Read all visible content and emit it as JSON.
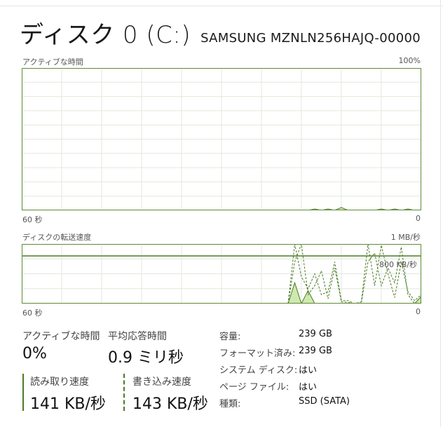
{
  "header": {
    "title": "ディスク 0 (C:)",
    "model": "SAMSUNG MZNLN256HAJQ-00000"
  },
  "active_chart": {
    "label": "アクティブな時間",
    "max_label": "100%",
    "x_left": "60 秒",
    "x_right": "0",
    "ylim": [
      0,
      100
    ],
    "series": [
      {
        "values": [
          0,
          0,
          0,
          0,
          0,
          0,
          0,
          0,
          0,
          0,
          0,
          0,
          0,
          0,
          0,
          0,
          0,
          0,
          0,
          0,
          0,
          0,
          0,
          0,
          0,
          0,
          0,
          0,
          0,
          0,
          0,
          0,
          0,
          0,
          0,
          0,
          0,
          0,
          0,
          0,
          0,
          0,
          0,
          0,
          1,
          0,
          1,
          0,
          2,
          0,
          0,
          0,
          0,
          0,
          1,
          0,
          1,
          0,
          1,
          0,
          0
        ]
      }
    ]
  },
  "transfer_chart": {
    "label": "ディスクの転送速度",
    "max_label": "1 MB/秒",
    "ref_label": "800 KB/秒",
    "x_left": "60 秒",
    "x_right": "0",
    "ylim": [
      0,
      1000
    ],
    "ref_value": 800,
    "series": [
      {
        "name": "read",
        "style": "solid",
        "values": [
          0,
          0,
          0,
          0,
          0,
          0,
          0,
          0,
          0,
          0,
          0,
          0,
          0,
          0,
          0,
          0,
          0,
          0,
          0,
          0,
          0,
          0,
          0,
          0,
          0,
          0,
          0,
          0,
          0,
          0,
          0,
          0,
          0,
          0,
          0,
          0,
          0,
          0,
          0,
          0,
          0,
          350,
          0,
          220,
          0,
          0,
          0,
          0,
          0,
          0,
          0,
          0,
          0,
          0,
          0,
          0,
          0,
          0,
          0,
          0,
          120
        ]
      },
      {
        "name": "write",
        "style": "dashed",
        "values": [
          0,
          0,
          0,
          0,
          0,
          0,
          0,
          0,
          0,
          0,
          0,
          0,
          0,
          0,
          0,
          0,
          0,
          0,
          0,
          0,
          0,
          0,
          0,
          0,
          0,
          0,
          0,
          0,
          0,
          0,
          0,
          0,
          0,
          0,
          0,
          0,
          0,
          0,
          0,
          0,
          0,
          0,
          0,
          0,
          0,
          0,
          0,
          0,
          0,
          0,
          0,
          0,
          0,
          0,
          0,
          0,
          0,
          0,
          0,
          0,
          0
        ]
      }
    ],
    "dashed_lines": [
      [
        0,
        0,
        0,
        0,
        0,
        0,
        0,
        0,
        0,
        0,
        0,
        0,
        0,
        0,
        0,
        0,
        0,
        0,
        0,
        0,
        0,
        0,
        0,
        0,
        0,
        0,
        0,
        0,
        0,
        0,
        0,
        0,
        0,
        0,
        0,
        0,
        0,
        0,
        0,
        0,
        0,
        1000,
        450,
        250,
        500,
        150,
        200,
        700,
        50,
        50,
        0,
        30,
        1000,
        300,
        980,
        500,
        100,
        700,
        200,
        50,
        150
      ],
      [
        0,
        0,
        0,
        0,
        0,
        0,
        0,
        0,
        0,
        0,
        0,
        0,
        0,
        0,
        0,
        0,
        0,
        0,
        0,
        0,
        0,
        0,
        0,
        0,
        0,
        0,
        0,
        0,
        0,
        0,
        0,
        0,
        0,
        0,
        0,
        0,
        0,
        0,
        0,
        0,
        0,
        700,
        1000,
        150,
        300,
        550,
        80,
        600,
        30,
        20,
        0,
        10,
        700,
        850,
        300,
        600,
        350,
        950,
        150,
        0,
        120
      ]
    ]
  },
  "stats": {
    "active_label": "アクティブな時間",
    "active_value": "0%",
    "resp_label": "平均応答時間",
    "resp_value": "0.9 ミリ秒",
    "read_label": "読み取り速度",
    "read_value": "141 KB/秒",
    "write_label": "書き込み速度",
    "write_value": "143 KB/秒"
  },
  "props": [
    {
      "k": "容量:",
      "v": "239 GB"
    },
    {
      "k": "フォーマット済み:",
      "v": "239 GB"
    },
    {
      "k": "システム ディスク:",
      "v": "はい"
    },
    {
      "k": "ページ ファイル:",
      "v": "はい"
    },
    {
      "k": "種類:",
      "v": "SSD (SATA)"
    }
  ],
  "colors": {
    "border": "#5f8a35",
    "grid": "#e3e8dc",
    "fill": "#cfe8b0",
    "line": "#4c7a26"
  }
}
